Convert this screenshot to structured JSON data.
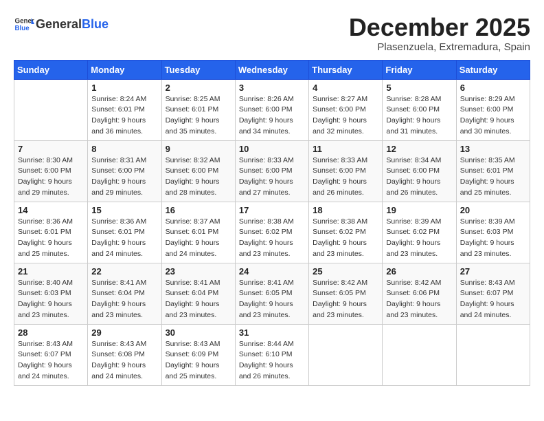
{
  "logo": {
    "general": "General",
    "blue": "Blue"
  },
  "title": "December 2025",
  "location": "Plasenzuela, Extremadura, Spain",
  "days_of_week": [
    "Sunday",
    "Monday",
    "Tuesday",
    "Wednesday",
    "Thursday",
    "Friday",
    "Saturday"
  ],
  "weeks": [
    [
      {
        "day": "",
        "info": ""
      },
      {
        "day": "1",
        "info": "Sunrise: 8:24 AM\nSunset: 6:01 PM\nDaylight: 9 hours\nand 36 minutes."
      },
      {
        "day": "2",
        "info": "Sunrise: 8:25 AM\nSunset: 6:01 PM\nDaylight: 9 hours\nand 35 minutes."
      },
      {
        "day": "3",
        "info": "Sunrise: 8:26 AM\nSunset: 6:00 PM\nDaylight: 9 hours\nand 34 minutes."
      },
      {
        "day": "4",
        "info": "Sunrise: 8:27 AM\nSunset: 6:00 PM\nDaylight: 9 hours\nand 32 minutes."
      },
      {
        "day": "5",
        "info": "Sunrise: 8:28 AM\nSunset: 6:00 PM\nDaylight: 9 hours\nand 31 minutes."
      },
      {
        "day": "6",
        "info": "Sunrise: 8:29 AM\nSunset: 6:00 PM\nDaylight: 9 hours\nand 30 minutes."
      }
    ],
    [
      {
        "day": "7",
        "info": "Sunrise: 8:30 AM\nSunset: 6:00 PM\nDaylight: 9 hours\nand 29 minutes."
      },
      {
        "day": "8",
        "info": "Sunrise: 8:31 AM\nSunset: 6:00 PM\nDaylight: 9 hours\nand 29 minutes."
      },
      {
        "day": "9",
        "info": "Sunrise: 8:32 AM\nSunset: 6:00 PM\nDaylight: 9 hours\nand 28 minutes."
      },
      {
        "day": "10",
        "info": "Sunrise: 8:33 AM\nSunset: 6:00 PM\nDaylight: 9 hours\nand 27 minutes."
      },
      {
        "day": "11",
        "info": "Sunrise: 8:33 AM\nSunset: 6:00 PM\nDaylight: 9 hours\nand 26 minutes."
      },
      {
        "day": "12",
        "info": "Sunrise: 8:34 AM\nSunset: 6:00 PM\nDaylight: 9 hours\nand 26 minutes."
      },
      {
        "day": "13",
        "info": "Sunrise: 8:35 AM\nSunset: 6:01 PM\nDaylight: 9 hours\nand 25 minutes."
      }
    ],
    [
      {
        "day": "14",
        "info": "Sunrise: 8:36 AM\nSunset: 6:01 PM\nDaylight: 9 hours\nand 25 minutes."
      },
      {
        "day": "15",
        "info": "Sunrise: 8:36 AM\nSunset: 6:01 PM\nDaylight: 9 hours\nand 24 minutes."
      },
      {
        "day": "16",
        "info": "Sunrise: 8:37 AM\nSunset: 6:01 PM\nDaylight: 9 hours\nand 24 minutes."
      },
      {
        "day": "17",
        "info": "Sunrise: 8:38 AM\nSunset: 6:02 PM\nDaylight: 9 hours\nand 23 minutes."
      },
      {
        "day": "18",
        "info": "Sunrise: 8:38 AM\nSunset: 6:02 PM\nDaylight: 9 hours\nand 23 minutes."
      },
      {
        "day": "19",
        "info": "Sunrise: 8:39 AM\nSunset: 6:02 PM\nDaylight: 9 hours\nand 23 minutes."
      },
      {
        "day": "20",
        "info": "Sunrise: 8:39 AM\nSunset: 6:03 PM\nDaylight: 9 hours\nand 23 minutes."
      }
    ],
    [
      {
        "day": "21",
        "info": "Sunrise: 8:40 AM\nSunset: 6:03 PM\nDaylight: 9 hours\nand 23 minutes."
      },
      {
        "day": "22",
        "info": "Sunrise: 8:41 AM\nSunset: 6:04 PM\nDaylight: 9 hours\nand 23 minutes."
      },
      {
        "day": "23",
        "info": "Sunrise: 8:41 AM\nSunset: 6:04 PM\nDaylight: 9 hours\nand 23 minutes."
      },
      {
        "day": "24",
        "info": "Sunrise: 8:41 AM\nSunset: 6:05 PM\nDaylight: 9 hours\nand 23 minutes."
      },
      {
        "day": "25",
        "info": "Sunrise: 8:42 AM\nSunset: 6:05 PM\nDaylight: 9 hours\nand 23 minutes."
      },
      {
        "day": "26",
        "info": "Sunrise: 8:42 AM\nSunset: 6:06 PM\nDaylight: 9 hours\nand 23 minutes."
      },
      {
        "day": "27",
        "info": "Sunrise: 8:43 AM\nSunset: 6:07 PM\nDaylight: 9 hours\nand 24 minutes."
      }
    ],
    [
      {
        "day": "28",
        "info": "Sunrise: 8:43 AM\nSunset: 6:07 PM\nDaylight: 9 hours\nand 24 minutes."
      },
      {
        "day": "29",
        "info": "Sunrise: 8:43 AM\nSunset: 6:08 PM\nDaylight: 9 hours\nand 24 minutes."
      },
      {
        "day": "30",
        "info": "Sunrise: 8:43 AM\nSunset: 6:09 PM\nDaylight: 9 hours\nand 25 minutes."
      },
      {
        "day": "31",
        "info": "Sunrise: 8:44 AM\nSunset: 6:10 PM\nDaylight: 9 hours\nand 26 minutes."
      },
      {
        "day": "",
        "info": ""
      },
      {
        "day": "",
        "info": ""
      },
      {
        "day": "",
        "info": ""
      }
    ]
  ]
}
